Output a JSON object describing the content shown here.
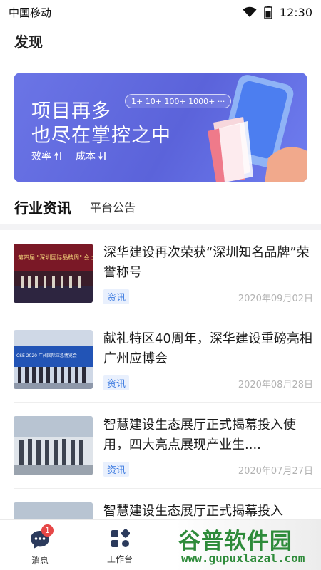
{
  "status_bar": {
    "carrier": "中国移动",
    "time": "12:30"
  },
  "header": {
    "title": "发现"
  },
  "banner": {
    "line1": "项目再多",
    "line2": "也尽在掌控之中",
    "counter": "1+ 10+ 100+ 1000+ ···",
    "sub_efficiency": "效率",
    "sub_cost": "成本"
  },
  "tabs": {
    "active": "行业资讯",
    "other": "平台公告"
  },
  "news": [
    {
      "title": "深华建设再次荣获“深圳知名品牌”荣誉称号",
      "tag": "资讯",
      "date": "2020年09月02日",
      "thumb_text": "第四届 \"深圳国际品牌周\" 会 大"
    },
    {
      "title": "献礼特区40周年，深华建设重磅亮相广州应博会",
      "tag": "资讯",
      "date": "2020年08月28日",
      "thumb_text": "CSE 2020 广州国际应急博览会"
    },
    {
      "title": "智慧建设生态展厅正式揭幕投入使用，四大亮点展现产业生....",
      "tag": "资讯",
      "date": "2020年07月27日",
      "thumb_text": ""
    },
    {
      "title": "智慧建设生态展厅正式揭幕投入",
      "tag": "",
      "date": "",
      "thumb_text": ""
    }
  ],
  "bottom_nav": {
    "messages_label": "消息",
    "messages_badge": "1",
    "workbench_label": "工作台"
  },
  "watermark": {
    "big": "谷普软件园",
    "small": "www.gupuxlazal.com"
  },
  "colors": {
    "banner_start": "#6b75e6",
    "banner_end": "#6f7ef0",
    "tag_bg": "#e9f0fd",
    "tag_text": "#3d7be0",
    "badge": "#e64747",
    "nav_icon": "#2b3a5c"
  }
}
